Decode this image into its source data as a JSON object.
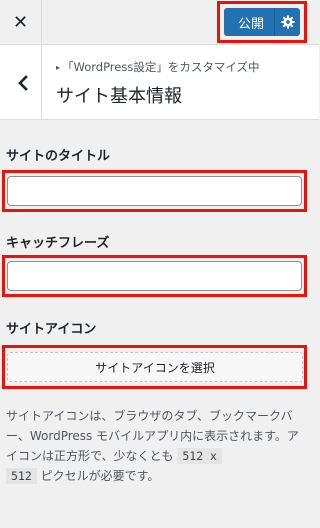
{
  "topbar": {
    "close_glyph": "✕",
    "publish_label": "公開"
  },
  "header": {
    "breadcrumb": "「WordPress設定」をカスタマイズ中",
    "title": "サイト基本情報"
  },
  "site_title": {
    "label": "サイトのタイトル",
    "value": ""
  },
  "tagline": {
    "label": "キャッチフレーズ",
    "value": ""
  },
  "site_icon": {
    "label": "サイトアイコン",
    "button_label": "サイトアイコンを選択",
    "desc_1": "サイトアイコンは、ブラウザのタブ、ブックマークバー、WordPress モバイルアプリ内に表示されます。アイコンは正方形で、少なくとも ",
    "size_1": "512 x",
    "size_2": "512",
    "desc_2": " ピクセルが必要です。"
  },
  "colors": {
    "highlight": "#e8140a",
    "primary": "#2271b1"
  },
  "icons": {
    "close": "close-icon",
    "gear": "gear-icon",
    "back": "chevron-left-icon",
    "breadcrumb": "triangle-right-icon"
  }
}
